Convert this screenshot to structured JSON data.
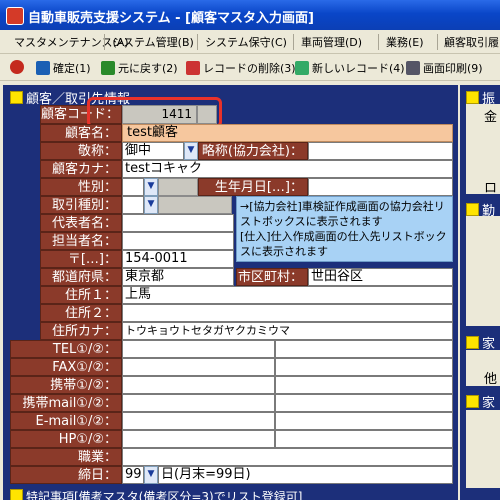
{
  "window": {
    "title": "自動車販売支援システム - [顧客マスタ入力画面]"
  },
  "menu": [
    "マスタメンテナンス(A)",
    "システム管理(B)",
    "システム保守(C)",
    "車両管理(D)",
    "業務(E)",
    "顧客取引履"
  ],
  "toolbar": [
    {
      "label": "確定(1)",
      "icon": "confirm-icon",
      "color": "#d22"
    },
    {
      "label": "元に戻す(2)",
      "icon": "undo-icon",
      "color": "#2a8a2a"
    },
    {
      "label": "レコードの削除(3)",
      "icon": "delete-record-icon",
      "color": "#c33"
    },
    {
      "label": "新しいレコード(4)",
      "icon": "new-record-icon",
      "color": "#3a6"
    },
    {
      "label": "画面印刷(9)",
      "icon": "print-icon",
      "color": "#556"
    }
  ],
  "section": {
    "title": "顧客／取引先情報"
  },
  "labels": {
    "customer_code": "顧客コード：",
    "customer_name": "顧客名：",
    "honorific": "敬称：",
    "short_name": "略称(協力会社)：",
    "customer_kana": "顧客カナ：",
    "gender": "性別：",
    "birthday": "生年月日[…]：",
    "trade_type": "取引種別：",
    "representative": "代表者名：",
    "contact": "担当者名：",
    "postal": "〒[…]：",
    "prefecture": "都道府県：",
    "city": "市区町村：",
    "address1": "住所１：",
    "address2": "住所２：",
    "address_kana": "住所カナ：",
    "tel": "TEL①/②：",
    "fax": "FAX①/②：",
    "mobile": "携帯①/②：",
    "mobile_mail": "携帯mail①/②：",
    "email": "E-mail①/②：",
    "hp": "HP①/②：",
    "job": "職業：",
    "closing": "締日："
  },
  "values": {
    "customer_code": "1411",
    "customer_name": "test顧客",
    "honorific": "御中",
    "customer_kana": "testコキャク",
    "postal": "154-0011",
    "prefecture": "東京都",
    "city": "世田谷区",
    "address1": "上馬",
    "address_kana": "トウキョウトセタガヤクカミウマ",
    "closing_day": "99",
    "closing_suffix": "日(月末=99日)"
  },
  "note": {
    "text": "→[協力会社]車検証作成画面の協力会社リストボックスに表示されます\n[仕入]仕入作成画面の仕入先リストボックスに表示されます"
  },
  "right": {
    "h1": "振",
    "c1": "金",
    "c2": "ロ",
    "h2": "勤",
    "h3": "家",
    "c3": "他",
    "h4": "家"
  },
  "bottom": {
    "text": "特記事項[備考マスタ(備考区分=3)でリスト登録可]"
  },
  "colors": {
    "label_bg": "#8b3a2a",
    "panel_bg": "#1c2f7a",
    "note_bg": "#a8d2f5",
    "highlight": "#e8322a"
  }
}
